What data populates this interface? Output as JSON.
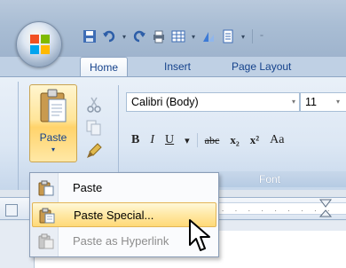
{
  "tabs": {
    "items": [
      "Home",
      "Insert",
      "Page Layout"
    ]
  },
  "clipboard": {
    "paste_label": "Paste",
    "paste_dropdown_glyph": "▾"
  },
  "font": {
    "family": "Calibri (Body)",
    "size": "11",
    "dropdown_glyph": "▾",
    "group_label": "Font",
    "format_buttons": [
      "B",
      "I",
      "U",
      "▾",
      "abc",
      "x₂",
      "x²",
      "Aa"
    ]
  },
  "paste_menu": {
    "items": [
      {
        "label": "Paste",
        "state": "normal"
      },
      {
        "label": "Paste Special...",
        "state": "highlighted"
      },
      {
        "label": "Paste as Hyperlink",
        "state": "disabled"
      }
    ]
  },
  "colors": {
    "accent": "#15428b",
    "highlight": "#ffe8a4",
    "ribbon": "#dce7f4"
  },
  "icons": [
    "office-logo-icon",
    "save-icon",
    "undo-icon",
    "redo-icon",
    "print-icon",
    "table-icon",
    "chart-icon",
    "paste-clipboard-icon",
    "cut-icon",
    "copy-icon",
    "format-painter-icon",
    "cursor-icon"
  ]
}
